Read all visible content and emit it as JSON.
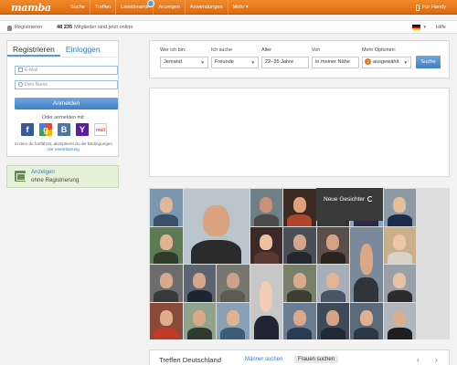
{
  "header": {
    "logo": "mamba",
    "nav": [
      "Suche",
      "Treffen",
      "Livestreams",
      "Anzeigen",
      "Anwendungen",
      "Mehr ▾"
    ],
    "handy": "Für Handy"
  },
  "subbar": {
    "register": "Registrieren",
    "member_count": "48 235",
    "member_text": "Mitglieder sind jetzt online",
    "language_caret": "▾",
    "help": "Hilfe"
  },
  "login": {
    "tab_register": "Registrieren",
    "tab_login": "Einloggen",
    "email_placeholder": "E-Mail",
    "name_placeholder": "Dein Name",
    "submit": "Anmelden",
    "or_label": "Oder anmelden mit:",
    "social": [
      "f",
      "g",
      "B",
      "Y",
      "mail"
    ],
    "terms_text": "In dem du fortfährst, akzeptierst du die Bedingungen",
    "terms_link": "die Vereinbarung"
  },
  "ads": {
    "title": "Anzeigen",
    "subtitle": "ohne Registrierung"
  },
  "search": {
    "labels": [
      "Wer ich bin:",
      "Ich suche",
      "Alter",
      "Von",
      "Mehr Optionen:"
    ],
    "values": [
      "Jemand",
      "Freunde",
      "22–35 Jahre",
      "in meiner Nähe",
      "ausgewählt"
    ],
    "options_count": "2",
    "button": "Suche"
  },
  "photos": {
    "new_faces_label": "Neue Gesichter"
  },
  "bottom": {
    "title": "Treffen Deutschland",
    "tab_men": "Männer suchen",
    "tab_women": "Frauen suchen",
    "prev": "‹",
    "next": "›"
  },
  "colors": {
    "accent": "#e8711c",
    "link": "#2a7cc7",
    "button": "#4f8fd0"
  }
}
